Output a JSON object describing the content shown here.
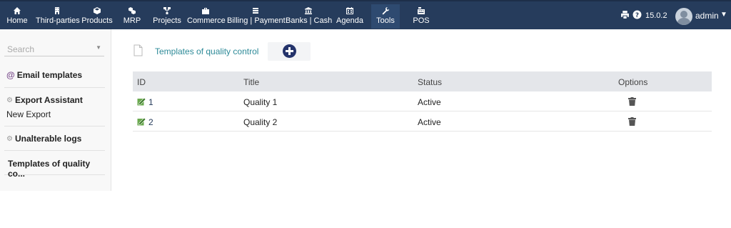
{
  "nav": {
    "items": [
      {
        "label": "Home",
        "icon": "home-icon"
      },
      {
        "label": "Third-parties",
        "icon": "building-icon"
      },
      {
        "label": "Products",
        "icon": "cube-icon"
      },
      {
        "label": "MRP",
        "icon": "cubes-icon"
      },
      {
        "label": "Projects",
        "icon": "sitemap-icon"
      },
      {
        "label": "Commerce",
        "icon": "suitcase-icon"
      },
      {
        "label": "Billing | Payment",
        "icon": "money-icon"
      },
      {
        "label": "Banks | Cash",
        "icon": "bank-icon"
      },
      {
        "label": "Agenda",
        "icon": "calendar-icon"
      },
      {
        "label": "Tools",
        "icon": "wrench-icon"
      },
      {
        "label": "POS",
        "icon": "cash-register-icon"
      }
    ],
    "active": "Tools",
    "version": "15.0.2",
    "user": "admin"
  },
  "sidebar": {
    "search_placeholder": "Search",
    "blocks": [
      {
        "title": "Email templates",
        "sub": ""
      },
      {
        "title": "Export Assistant",
        "sub": "New Export"
      },
      {
        "title": "Unalterable logs",
        "sub": ""
      },
      {
        "title": "Templates of quality co...",
        "sub": ""
      }
    ]
  },
  "main": {
    "title": "Templates of quality control",
    "columns": {
      "id": "ID",
      "title": "Title",
      "status": "Status",
      "options": "Options"
    },
    "rows": [
      {
        "id": "1",
        "title": "Quality 1",
        "status": "Active"
      },
      {
        "id": "2",
        "title": "Quality 2",
        "status": "Active"
      }
    ]
  },
  "colors": {
    "topbar": "#263c5c",
    "link": "#2d8a98",
    "add_button": "#24336b"
  }
}
